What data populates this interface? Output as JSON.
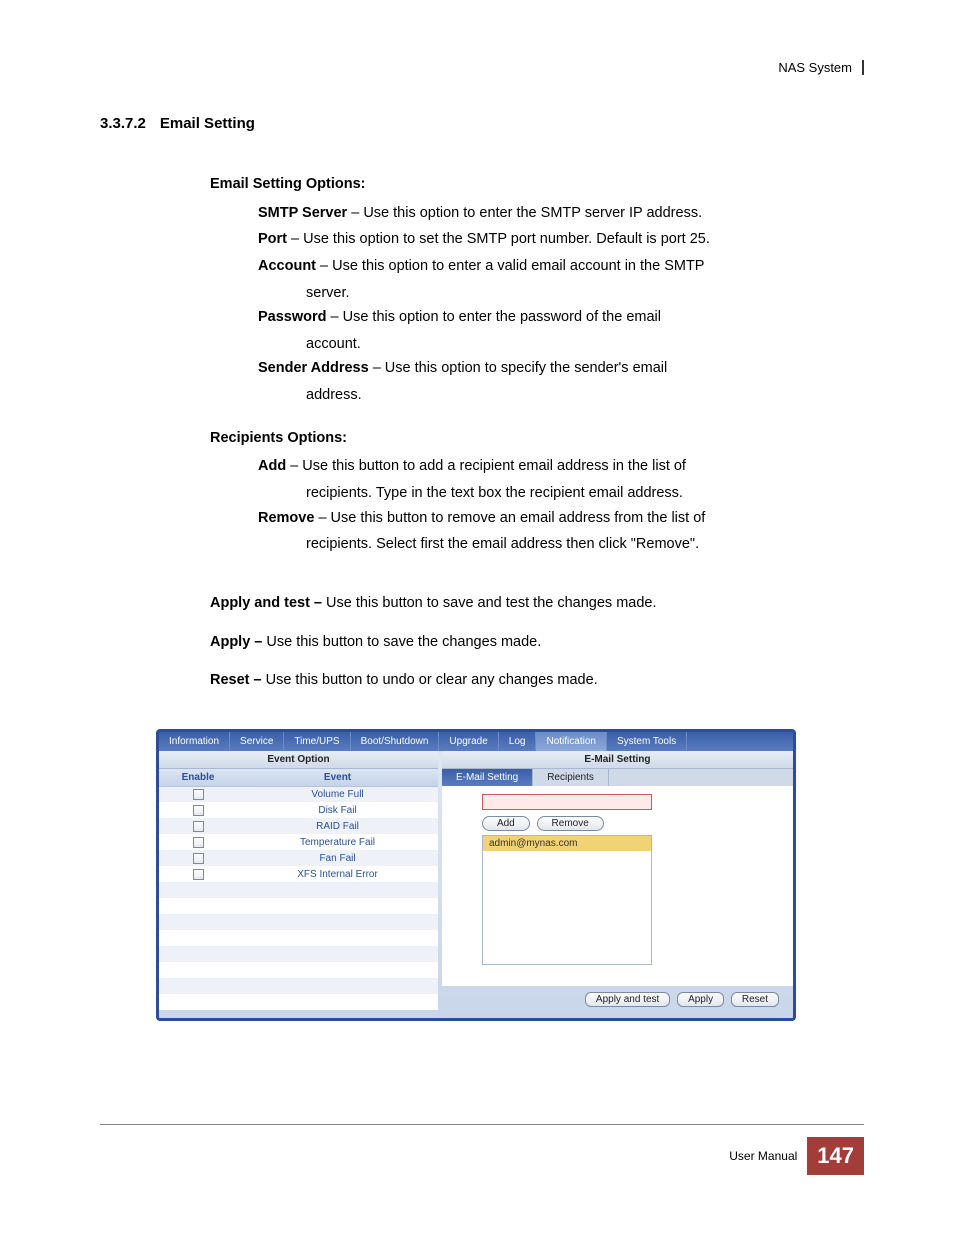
{
  "header": {
    "system": "NAS System"
  },
  "section": {
    "number": "3.3.7.2",
    "title": "Email Setting"
  },
  "email_options_heading": "Email Setting Options:",
  "email_options": [
    {
      "name": "SMTP Server",
      "desc": " – Use this option to enter the SMTP server IP address."
    },
    {
      "name": "Port",
      "desc": " – Use this option to set the SMTP port number. Default is port 25."
    },
    {
      "name": "Account",
      "desc": " – Use this option to enter a valid email account in the SMTP",
      "cont": "server."
    },
    {
      "name": "Password",
      "desc": " – Use this option to enter the password of the email",
      "cont": "account."
    },
    {
      "name": "Sender Address",
      "desc": " – Use this option to specify the sender's email",
      "cont": "address."
    }
  ],
  "recipients_heading": "Recipients Options:",
  "recipients_options": [
    {
      "name": "Add",
      "desc": " – Use this button to add a recipient email address in the list of",
      "cont": "recipients. Type in the text box the recipient email address."
    },
    {
      "name": "Remove",
      "desc": " – Use this button to remove an email address from the list of",
      "cont": "recipients. Select first the email address then click \"Remove\"."
    }
  ],
  "actions": [
    {
      "name": "Apply and test –",
      "desc": " Use this button to save and test the changes made."
    },
    {
      "name": "Apply –",
      "desc": " Use this button to save the changes made."
    },
    {
      "name": "Reset –",
      "desc": " Use this button to undo or clear any changes made."
    }
  ],
  "ui": {
    "tabs": [
      "Information",
      "Service",
      "Time/UPS",
      "Boot/Shutdown",
      "Upgrade",
      "Log",
      "Notification",
      "System Tools"
    ],
    "tabs_selected": "Notification",
    "left_title": "Event Option",
    "right_title": "E-Mail Setting",
    "event_headers": {
      "enable": "Enable",
      "event": "Event"
    },
    "events": [
      "Volume Full",
      "Disk Fail",
      "RAID Fail",
      "Temperature Fail",
      "Fan Fail",
      "XFS Internal Error"
    ],
    "subtabs": {
      "email": "E-Mail Setting",
      "recipients": "Recipients"
    },
    "buttons": {
      "add": "Add",
      "remove": "Remove",
      "apply_test": "Apply and test",
      "apply": "Apply",
      "reset": "Reset"
    },
    "recipients_list": [
      "admin@mynas.com"
    ]
  },
  "footer": {
    "label": "User Manual",
    "page": "147"
  }
}
